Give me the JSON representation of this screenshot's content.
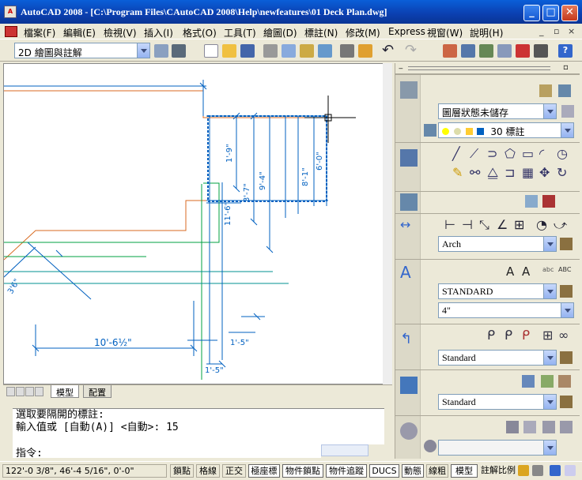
{
  "window": {
    "title": "AutoCAD 2008 - [C:\\Program Files\\CAutoCAD 2008\\Help\\newfeatures\\01 Deck Plan.dwg]",
    "minimize": "_",
    "maximize": "□",
    "close": "✕"
  },
  "menu": {
    "items": [
      "檔案(F)",
      "編輯(E)",
      "檢視(V)",
      "插入(I)",
      "格式(O)",
      "工具(T)",
      "繪圖(D)",
      "標註(N)",
      "修改(M)",
      "Express",
      "視窗(W)",
      "說明(H)"
    ],
    "controls": [
      "_",
      "▫",
      "×"
    ]
  },
  "toolbar": {
    "workspace": "2D 繪圖與註解"
  },
  "drawing": {
    "dimensions": [
      "1'-9\"",
      "6'-0\"",
      "3'-7\"",
      "9'-4\"",
      "8'-1\"",
      "11'-6\"",
      "10'-6½\"",
      "1'-5\"",
      "1'-5\"",
      "3'6\""
    ],
    "tabs": [
      "模型",
      "配置"
    ]
  },
  "command": {
    "line1": "選取要隔開的標註:",
    "line2": "輸入值或 [自動(A)] <自動>: 15",
    "prompt": "指令:"
  },
  "status": {
    "coords": "122'-0 3/8\", 46'-4 5/16\", 0'-0\"",
    "buttons": [
      "鎖點",
      "格線",
      "正交",
      "極座標",
      "物件鎖點",
      "物件追蹤",
      "DUCS",
      "動態",
      "線粗",
      "模型"
    ],
    "annotation_scale": "註解比例"
  },
  "palette": {
    "layer_state": "圖層狀態未儲存",
    "layer": "30 標註",
    "dimstyle": "Arch",
    "textstyle": "STANDARD",
    "textheight": "4\"",
    "mleaderstyle": "Standard",
    "tablestyle": "Standard",
    "text_labels": [
      "A",
      "A",
      "abc",
      "ABC"
    ]
  },
  "colors": {
    "titlebar": "#0b3fb0",
    "drawing_bg": "#ffffff",
    "dim_blue": "#0060c0",
    "line_orange": "#d86a20",
    "line_green": "#00a040",
    "line_teal": "#009090"
  }
}
